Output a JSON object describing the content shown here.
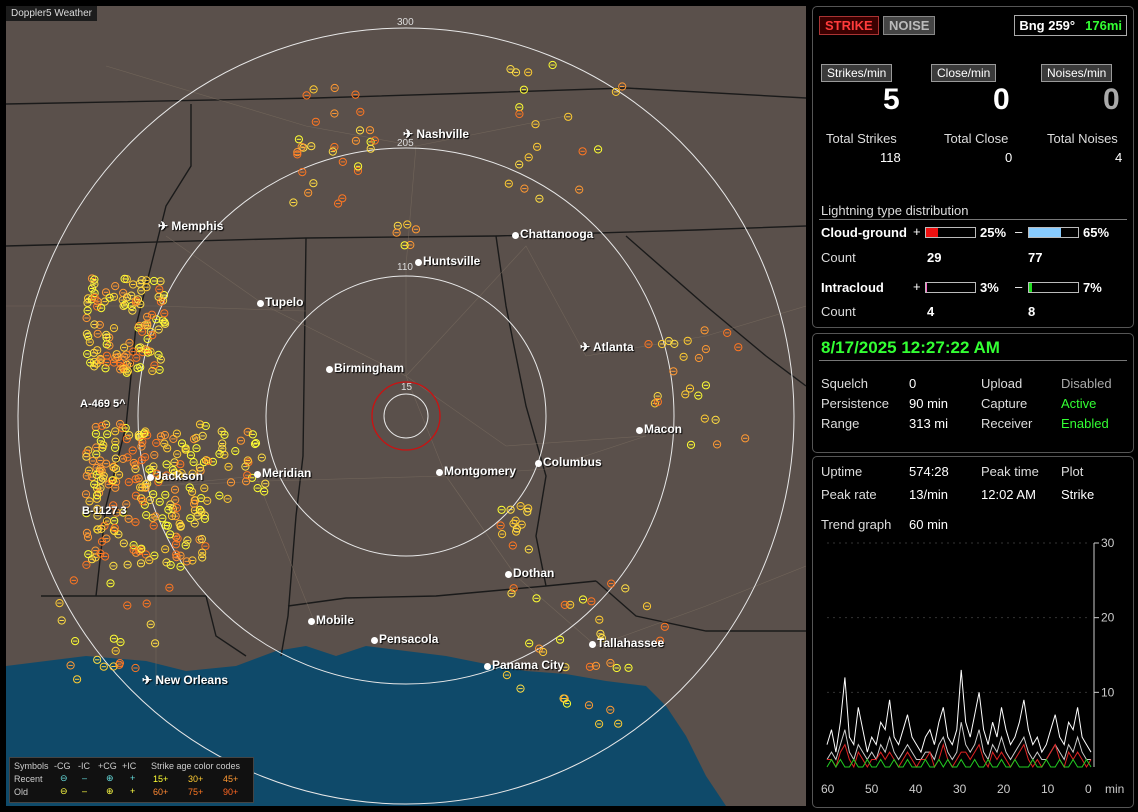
{
  "map": {
    "title": "Doppler5 Weather",
    "ring_labels": [
      "300",
      "205",
      "110",
      "15"
    ],
    "cities": [
      {
        "name": "Nashville",
        "airport": true
      },
      {
        "name": "Memphis",
        "airport": true
      },
      {
        "name": "Chattanooga",
        "airport": false
      },
      {
        "name": "Huntsville",
        "airport": false
      },
      {
        "name": "Tupelo",
        "airport": false
      },
      {
        "name": "Atlanta",
        "airport": true
      },
      {
        "name": "Birmingham",
        "airport": false
      },
      {
        "name": "Macon",
        "airport": false
      },
      {
        "name": "Jackson",
        "airport": false
      },
      {
        "name": "Meridian",
        "airport": false
      },
      {
        "name": "Montgomery",
        "airport": false
      },
      {
        "name": "Columbus",
        "airport": false
      },
      {
        "name": "Dothan",
        "airport": false
      },
      {
        "name": "Mobile",
        "airport": false
      },
      {
        "name": "Pensacola",
        "airport": false
      },
      {
        "name": "Tallahassee",
        "airport": false
      },
      {
        "name": "Panama City",
        "airport": false
      },
      {
        "name": "New Orleans",
        "airport": true
      }
    ],
    "markers": [
      "A-469 5^",
      "B-1127 3"
    ],
    "legend": {
      "symbols": "Symbols",
      "cols": [
        "-CG",
        "-IC",
        "+CG",
        "+IC"
      ],
      "recent": "Recent",
      "old": "Old",
      "age_title": "Strike age color codes",
      "ages_row1": [
        "15+",
        "30+",
        "45+"
      ],
      "ages_row2": [
        "60+",
        "75+",
        "90+"
      ]
    },
    "colors": {
      "land": "#5a504b",
      "water": "#0f4a6a",
      "ring": "#e8e8e8",
      "inner_ring": "#cc1111"
    }
  },
  "header": {
    "strike_btn": "STRIKE",
    "noise_btn": "NOISE",
    "bearing": "Bng 259°",
    "distance": "176mi"
  },
  "rates": {
    "strikes_label": "Strikes/min",
    "strikes": "5",
    "close_label": "Close/min",
    "close": "0",
    "noises_label": "Noises/min",
    "noises": "0"
  },
  "totals": {
    "strikes_label": "Total Strikes",
    "strikes": "118",
    "close_label": "Total Close",
    "close": "0",
    "noises_label": "Total Noises",
    "noises": "4"
  },
  "distribution": {
    "title": "Lightning type distribution",
    "cg_label": "Cloud-ground",
    "cg_pos_pct": "25%",
    "cg_neg_pct": "65%",
    "cg_pos_frac": 0.25,
    "cg_neg_frac": 0.65,
    "count_label": "Count",
    "cg_pos_count": "29",
    "cg_neg_count": "77",
    "ic_label": "Intracloud",
    "ic_pos_pct": "3%",
    "ic_neg_pct": "7%",
    "ic_pos_frac": 0.03,
    "ic_neg_frac": 0.07,
    "ic_pos_count": "4",
    "ic_neg_count": "8",
    "plus": "+",
    "minus": "–"
  },
  "status": {
    "datetime": "8/17/2025 12:27:22 AM",
    "squelch_label": "Squelch",
    "squelch": "0",
    "upload_label": "Upload",
    "upload": "Disabled",
    "persistence_label": "Persistence",
    "persistence": "90 min",
    "capture_label": "Capture",
    "capture": "Active",
    "range_label": "Range",
    "range": "313 mi",
    "receiver_label": "Receiver",
    "receiver": "Enabled"
  },
  "stats": {
    "uptime_label": "Uptime",
    "uptime": "574:28",
    "peak_time_label": "Peak time",
    "plot_label": "Plot",
    "peak_rate_label": "Peak rate",
    "peak_rate": "13/min",
    "peak_time": "12:02 AM",
    "plot": "Strike",
    "trend_label": "Trend graph",
    "trend": "60 min"
  },
  "chart_data": {
    "type": "line",
    "x_ticks": [
      "60",
      "50",
      "40",
      "30",
      "20",
      "10",
      "0"
    ],
    "xlabel": "min",
    "y_ticks": [
      "30",
      "20",
      "10"
    ],
    "ylim": [
      0,
      30
    ],
    "xlim": [
      60,
      0
    ],
    "series": [
      {
        "color": "#ffffff",
        "values": [
          3,
          5,
          2,
          6,
          12,
          4,
          3,
          8,
          5,
          2,
          4,
          3,
          6,
          5,
          9,
          4,
          3,
          5,
          7,
          4,
          3,
          2,
          4,
          5,
          3,
          6,
          8,
          4,
          3,
          5,
          13,
          6,
          4,
          7,
          10,
          5,
          3,
          6,
          4,
          8,
          5,
          3,
          4,
          6,
          9,
          5,
          3,
          4,
          2,
          3,
          5,
          7,
          4,
          3,
          6,
          5,
          8,
          4,
          3,
          2
        ]
      },
      {
        "color": "#cccccc",
        "values": [
          1,
          2,
          1,
          3,
          5,
          2,
          1,
          3,
          2,
          1,
          2,
          1,
          3,
          2,
          4,
          2,
          1,
          2,
          3,
          2,
          1,
          1,
          2,
          2,
          1,
          3,
          4,
          2,
          1,
          2,
          6,
          3,
          2,
          3,
          5,
          2,
          1,
          3,
          2,
          4,
          2,
          1,
          2,
          3,
          4,
          2,
          1,
          2,
          1,
          1,
          2,
          3,
          2,
          1,
          3,
          2,
          4,
          2,
          1,
          1
        ]
      },
      {
        "color": "#dd2222",
        "values": [
          1,
          1,
          0,
          2,
          3,
          1,
          0,
          2,
          1,
          0,
          1,
          1,
          2,
          1,
          2,
          1,
          0,
          1,
          2,
          1,
          0,
          1,
          1,
          2,
          0,
          1,
          3,
          1,
          0,
          1,
          2,
          2,
          1,
          2,
          3,
          1,
          0,
          2,
          1,
          2,
          1,
          0,
          1,
          2,
          3,
          1,
          0,
          1,
          0,
          1,
          2,
          3,
          1,
          0,
          2,
          1,
          2,
          1,
          0,
          1
        ]
      },
      {
        "color": "#22cc22",
        "values": [
          0,
          1,
          0,
          1,
          0,
          0,
          1,
          0,
          0,
          1,
          0,
          0,
          1,
          0,
          0,
          1,
          0,
          0,
          1,
          0,
          0,
          0,
          1,
          0,
          0,
          1,
          0,
          1,
          0,
          0,
          1,
          0,
          0,
          1,
          0,
          0,
          1,
          0,
          0,
          1,
          0,
          0,
          1,
          0,
          0,
          0,
          1,
          0,
          0,
          1,
          0,
          0,
          1,
          0,
          0,
          1,
          0,
          0,
          1,
          0
        ]
      }
    ]
  }
}
